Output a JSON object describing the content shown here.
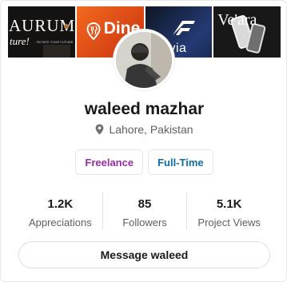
{
  "profile": {
    "name": "waleed mazhar",
    "location": "Lahore, Pakistan",
    "location_icon": "map-pin-icon"
  },
  "covers": [
    {
      "title_big": "AURUM.",
      "title_script": "ture!",
      "small": "ROTATE YOUR FUTURE"
    },
    {
      "title": "Dine Dine"
    },
    {
      "title": "via"
    },
    {
      "title": "Ve'ara"
    }
  ],
  "tags": [
    {
      "label": "Freelance",
      "color": "#9b2aa8"
    },
    {
      "label": "Full-Time",
      "color": "#0f6da3"
    }
  ],
  "stats": [
    {
      "value": "1.2K",
      "label": "Appreciations"
    },
    {
      "value": "85",
      "label": "Followers"
    },
    {
      "value": "5.1K",
      "label": "Project Views"
    }
  ],
  "actions": {
    "message_label": "Message waleed"
  }
}
